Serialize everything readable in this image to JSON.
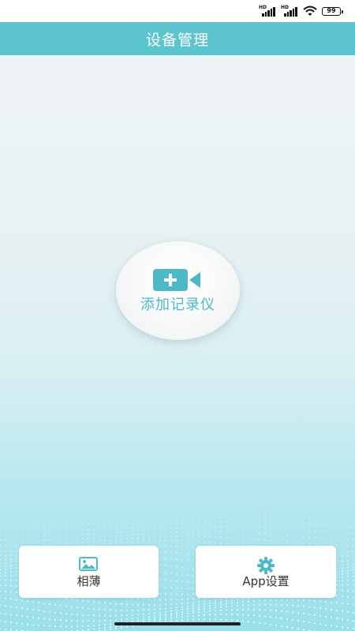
{
  "status_bar": {
    "signal1_label": "HD",
    "signal2_label": "HD",
    "battery_level": "99",
    "icon_color": "#111111"
  },
  "header": {
    "title": "设备管理",
    "background": "#5cc4cf"
  },
  "main": {
    "add_device_label": "添加记录仪",
    "add_device_icon": "video-camera-plus-icon",
    "accent_color": "#4cb8c8"
  },
  "bottom_nav": {
    "album_label": "相薄",
    "album_icon": "image-icon",
    "settings_label": "App设置",
    "settings_icon": "gear-icon"
  }
}
